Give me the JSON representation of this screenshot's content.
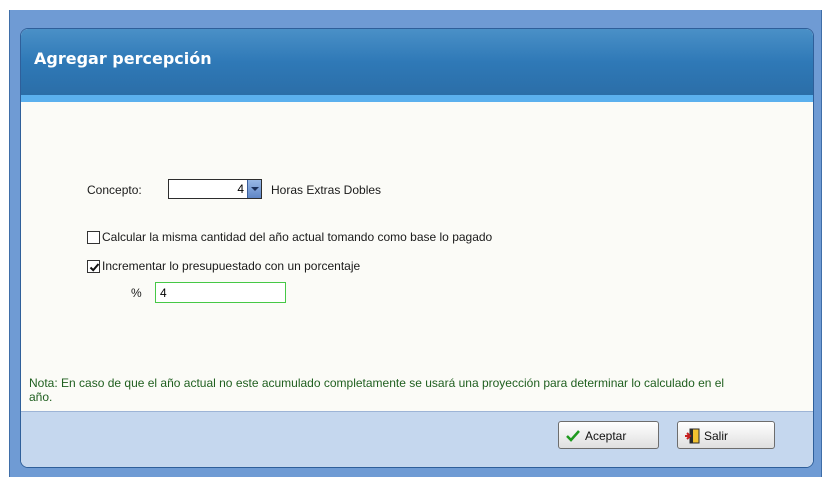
{
  "dialog": {
    "title": "Agregar percepción"
  },
  "concepto": {
    "label": "Concepto:",
    "value": "4",
    "description": "Horas Extras Dobles"
  },
  "options": [
    {
      "label": "Calcular la misma cantidad del año actual tomando como base lo pagado",
      "checked": false
    },
    {
      "label": "Incrementar lo presupuestado con un porcentaje",
      "checked": true
    }
  ],
  "percent": {
    "label": "%",
    "value": "4"
  },
  "note": "Nota: En caso de que el año actual no este acumulado completamente se usará una proyección para determinar lo calculado en el año.",
  "buttons": {
    "accept": "Aceptar",
    "exit": "Salir"
  },
  "colors": {
    "title_bar": "#2f79b7",
    "footer": "#c5d7ee",
    "input_focus_border": "#46c846",
    "note_text": "#1f5f1f"
  }
}
